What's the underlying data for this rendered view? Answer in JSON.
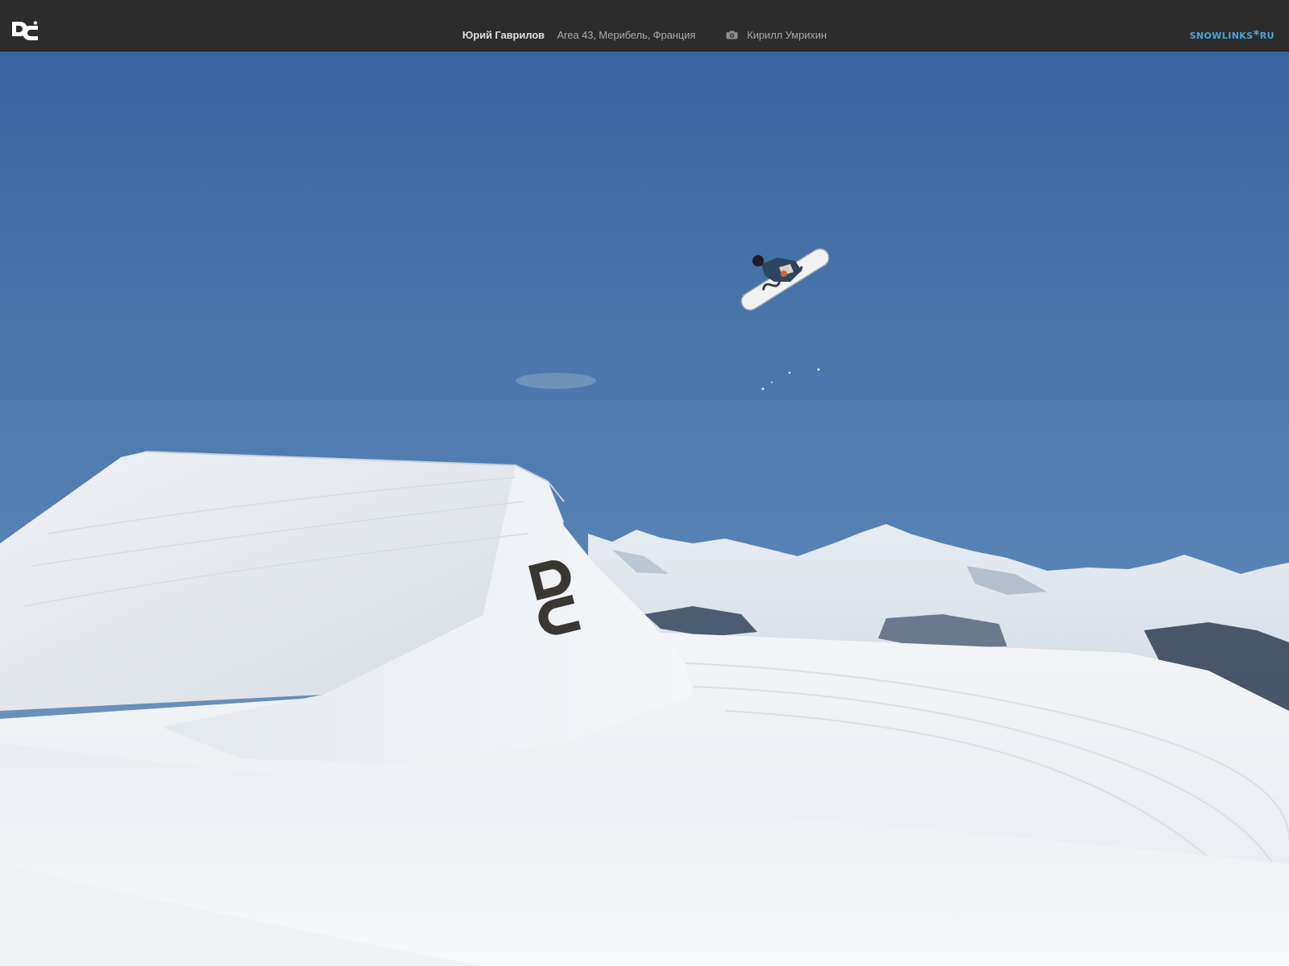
{
  "header": {
    "rider_name": "Юрий Гаврилов",
    "location": "Area 43, Мерибель, Франция",
    "photographer": "Кирилл Умрихин",
    "brand_logo_icon": "dc-logo-icon",
    "camera_icon": "camera-icon",
    "site_logo": "SNOWLINKS*RU"
  },
  "colors": {
    "topbar": "#2c2c2c",
    "site_logo": "#4aa3d8",
    "sky_top": "#3b66a0",
    "sky_horizon": "#7d9fbe",
    "snow": "#f2f4f7"
  }
}
